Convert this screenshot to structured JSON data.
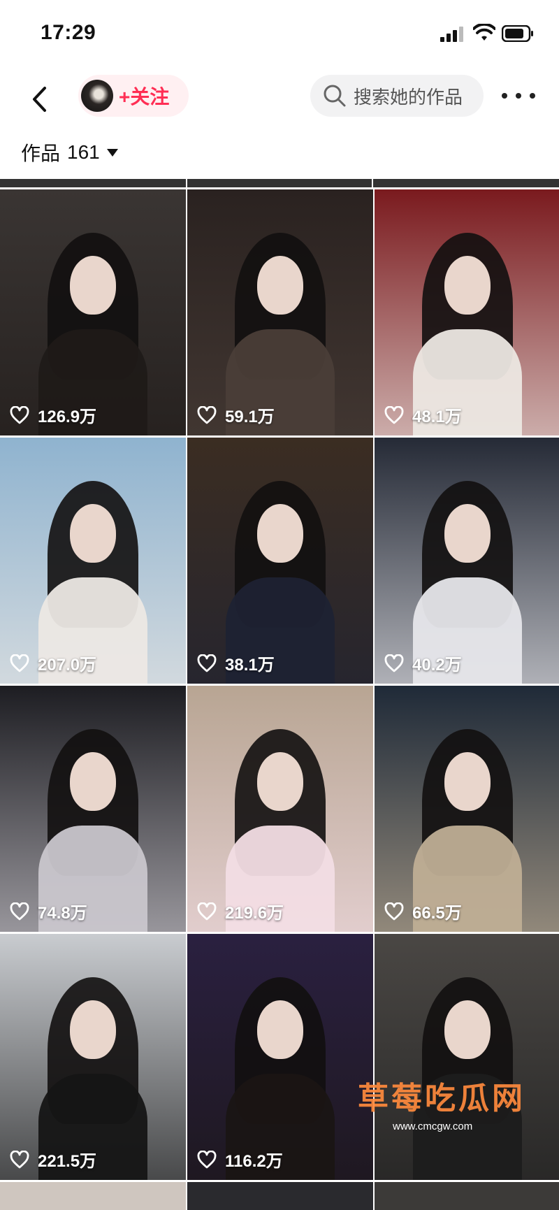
{
  "status_bar": {
    "time": "17:29"
  },
  "nav": {
    "follow_label": "+关注",
    "search_placeholder": "搜索她的作品"
  },
  "works": {
    "label": "作品",
    "count": "161"
  },
  "tiles": [
    {
      "likes": "126.9万",
      "bg": "#3a3533",
      "accent": "#1f1a18"
    },
    {
      "likes": "59.1万",
      "bg": "#2a2220",
      "accent": "#4a3e38"
    },
    {
      "likes": "48.1万",
      "bg": "#7a1a1e",
      "accent": "#ece7e2"
    },
    {
      "likes": "207.0万",
      "bg": "#8fb3cf",
      "accent": "#ece8e4"
    },
    {
      "likes": "38.1万",
      "bg": "#3b2d22",
      "accent": "#1e2233"
    },
    {
      "likes": "40.2万",
      "bg": "#252a36",
      "accent": "#e6e6ea"
    },
    {
      "likes": "74.8万",
      "bg": "#1d1d22",
      "accent": "#c9c6cc"
    },
    {
      "likes": "219.6万",
      "bg": "#b8a593",
      "accent": "#f2dde4"
    },
    {
      "likes": "66.5万",
      "bg": "#1f2a38",
      "accent": "#bfae95"
    },
    {
      "likes": "221.5万",
      "bg": "#c9ccd0",
      "accent": "#151515"
    },
    {
      "likes": "116.2万",
      "bg": "#2a2040",
      "accent": "#1a1514"
    },
    {
      "likes": "",
      "bg": "#4a4744",
      "accent": "#1c1c1c"
    }
  ],
  "watermark": {
    "title": "草莓吃瓜网",
    "url": "www.cmcgw.com"
  }
}
